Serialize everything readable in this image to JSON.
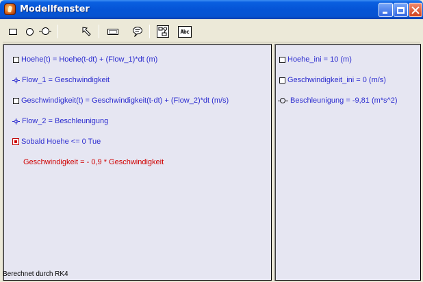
{
  "window": {
    "title": "Modellfenster"
  },
  "toolbar": {
    "tools": [
      {
        "icon": "rectangle-icon"
      },
      {
        "icon": "circle-icon"
      },
      {
        "icon": "circle-arrow-icon"
      },
      {
        "icon": "connector-arrow-icon"
      },
      {
        "icon": "rounded-rect-icon"
      },
      {
        "icon": "speech-bubble-icon"
      },
      {
        "icon": "diagram-icon"
      },
      {
        "icon": "text-abc-icon"
      }
    ],
    "abc_label": "Abc"
  },
  "left_panel": {
    "rows": [
      {
        "icon": "stock-square-icon",
        "text": "Hoehe(t) = Hoehe(t-dt) + (Flow_1)*dt (m)"
      },
      {
        "icon": "flow-icon",
        "text": "Flow_1 = Geschwindigkeit"
      },
      {
        "icon": "stock-square-icon",
        "text": "Geschwindigkeit(t) = Geschwindigkeit(t-dt) + (Flow_2)*dt (m/s)"
      },
      {
        "icon": "flow-icon",
        "text": "Flow_2 = Beschleunigung"
      },
      {
        "icon": "event-icon",
        "text": "Sobald Hoehe <= 0 Tue"
      }
    ],
    "event_action": "Geschwindigkeit = - 0,9 * Geschwindigkeit",
    "status": "Berechnet durch RK4"
  },
  "right_panel": {
    "rows": [
      {
        "icon": "stock-square-icon",
        "text": "Hoehe_ini = 10 (m)"
      },
      {
        "icon": "stock-square-icon",
        "text": "Geschwindigkeit_ini = 0 (m/s)"
      },
      {
        "icon": "converter-icon",
        "text": "Beschleunigung = -9,81 (m*s^2)"
      }
    ]
  },
  "colors": {
    "titlebar": "#0554d6",
    "equation_text": "#2b2bcf",
    "event_text": "#d00000",
    "panel_bg": "#e6e6f2"
  }
}
